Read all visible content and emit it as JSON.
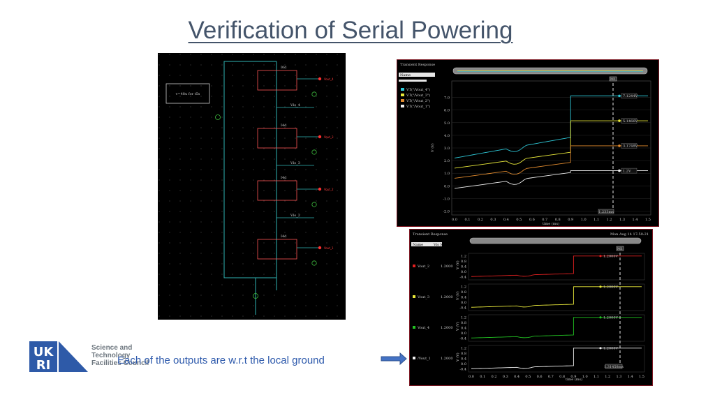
{
  "slide": {
    "title": "Verification of Serial Powering",
    "caption": "Each of the outputs are w.r.t the local ground",
    "logo": {
      "mark": "UKRI",
      "lines": [
        "Science and",
        "Technology",
        "Facilities Council"
      ]
    }
  },
  "schematic": {
    "note": "v=48u for t5s",
    "blocks": [
      {
        "label": "I0d",
        "output": "Vout_4",
        "ground": "Vlo_4"
      },
      {
        "label": "I4d",
        "output": "Vout_3",
        "ground": "Vlo_3"
      },
      {
        "label": "I4d",
        "output": "Vout_2",
        "ground": "Vlo_2"
      },
      {
        "label": "I4d",
        "output": "Vout_1",
        "ground": ""
      }
    ]
  },
  "transient1": {
    "title": "Transient Response",
    "sidebar_header": "Name",
    "marker": "M1",
    "legend": [
      {
        "name": "VT(\"/Vout_4\")",
        "color": "#2ec7d6"
      },
      {
        "name": "VT(\"/Vout_3\")",
        "color": "#e8e83a"
      },
      {
        "name": "VT(\"/Vout_2\")",
        "color": "#e08a2e"
      },
      {
        "name": "VT(\"/Vout_1\")",
        "color": "#f0f0f0"
      }
    ],
    "end_labels": [
      "7.1244V",
      "5.1466V",
      "3.1748V",
      "1.2V"
    ],
    "ylabel": "V (V)",
    "xlabel": "time (ms)",
    "yticks": [
      "7.0",
      "6.0",
      "5.0",
      "4.0",
      "3.0",
      "2.0",
      "1.0",
      "0.0",
      "-1.0",
      "-2.0"
    ],
    "xticks": [
      "0.0",
      "0.1",
      "0.2",
      "0.3",
      "0.4",
      "0.5",
      "0.6",
      "0.7",
      "0.8",
      "0.9",
      "1.0",
      "1.1",
      "1.2",
      "1.3",
      "1.4",
      "1.5"
    ],
    "cursor_label": "1.233ms"
  },
  "transient2": {
    "title": "Transient Response",
    "timestamp": "Mon Aug 14 17:50:21",
    "sidebar_header": "Name",
    "sidebar_header2": "Vis  M1",
    "marker": "M1",
    "rows": [
      {
        "name": "Vout_2",
        "value": "1.2000",
        "end": "1.2000V",
        "color": "#e02020"
      },
      {
        "name": "Vout_3",
        "value": "1.2000",
        "end": "1.2000V",
        "color": "#e8e83a"
      },
      {
        "name": "Vout_4",
        "value": "1.2000",
        "end": "1.2000V",
        "color": "#22c222"
      },
      {
        "name": "/Vout_1",
        "value": "1.2000",
        "end": "1.2000V",
        "color": "#f0f0f0"
      }
    ],
    "yticks": [
      "1.2",
      "0.8",
      "0.4",
      "0.0",
      "-0.4"
    ],
    "ylabel": "V (V)",
    "xlabel": "time (ms)",
    "xticks": [
      "0.0",
      "0.1",
      "0.2",
      "0.3",
      "0.4",
      "0.5",
      "0.6",
      "0.7",
      "0.8",
      "0.9",
      "1.0",
      "1.1",
      "1.2",
      "1.3",
      "1.4",
      "1.5"
    ],
    "cursor_label": "1.31458ms"
  }
}
